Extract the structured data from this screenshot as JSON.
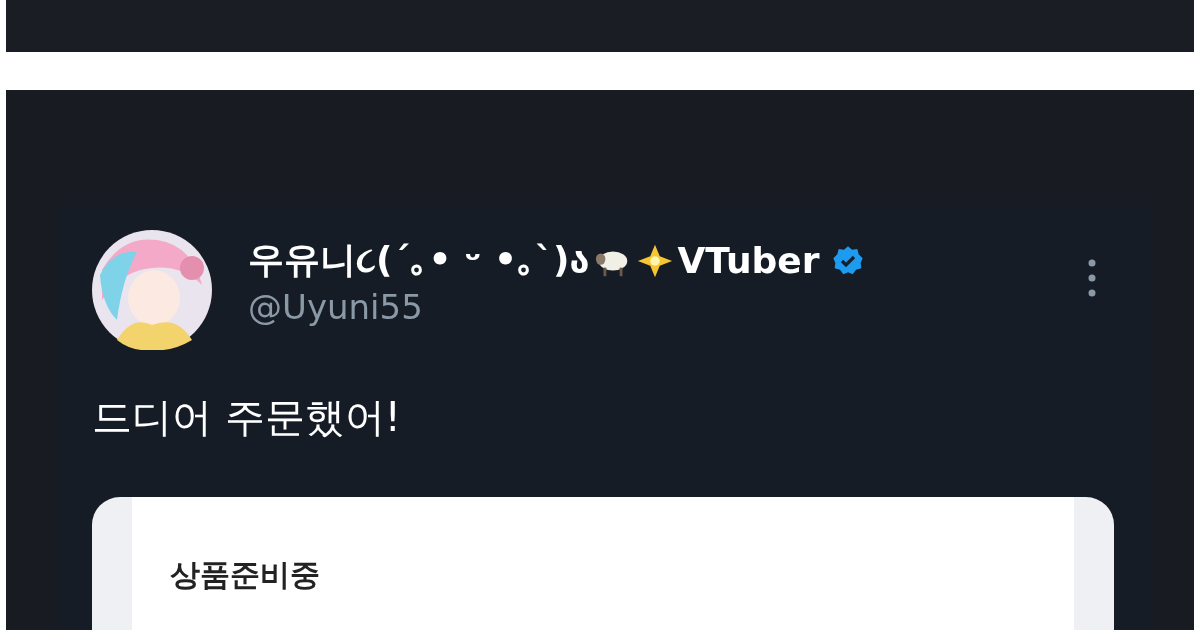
{
  "tweet": {
    "display_name": "우유니૮(´｡• ᵕ •｡`)ა",
    "display_name_suffix": "VTuber",
    "verified": true,
    "handle": "@Uyuni55",
    "text": "드디어 주문했어!"
  },
  "order_card": {
    "status": "상품준비중"
  }
}
